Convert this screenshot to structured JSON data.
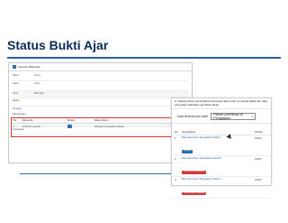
{
  "slide": {
    "title": "Status Bukti Ajar"
  },
  "left_panel": {
    "header": "Laporan Bukti Ajar",
    "fields": [
      {
        "label": "Nama",
        "value": "Dosen"
      },
      {
        "label": "Judul",
        "value": "Judul ..."
      },
      {
        "label": "Jenis",
        "value": "Bukti Ajar"
      },
      {
        "label": "Status",
        "value": ""
      }
    ],
    "sections": [
      "Pengajar"
    ],
    "fields2": [
      {
        "label": "Nama Dosen",
        "value": ""
      },
      {
        "label": "Tanggal",
        "value": "2024"
      },
      {
        "label": "Keterangan",
        "value": ""
      }
    ],
    "table": {
      "headers": [
        "No",
        "Nama File",
        "Berkas",
        "Status Sistem"
      ],
      "rows": [
        {
          "no": "1",
          "file": "Dokumen Ajar.pdf",
          "status": "Disetujui Pengesahan Ditolak ..."
        }
      ]
    }
  },
  "right_panel": {
    "info": "A. Rekomendasi pemindahan kelompok data untuk, termasuk daftar dan data yang akan dilakukan pemilihan lanjut.",
    "select_label": "Data tersedia dari tabel",
    "select_value": "Pilihan pemilihan di Pengajaran",
    "table": {
      "headers": [
        "No",
        "Pengaduan",
        "Pilihan"
      ],
      "rows": [
        {
          "no": "1",
          "name": "Bukti Ajar Dosen Pengajaran Kuliah A",
          "badge": "Disetujui",
          "badge_color": "blue",
          "value": "100%"
        },
        {
          "no": "2",
          "name": "Bukti Ajar Dosen Pengajaran Kuliah B",
          "badge": "Ditolak untuk Perbaikan",
          "badge_color": "red",
          "value": "100%"
        },
        {
          "no": "3",
          "name": "Bukti Ajar Dosen Pengajaran Kuliah C",
          "badge": "Ditolak untuk Perbaikan",
          "badge_color": "red",
          "value": "100%"
        }
      ]
    }
  },
  "colors": {
    "title": "#0a2a5a",
    "accent": "#2b5fa8",
    "highlight": "#e03030",
    "badge_blue": "#2a6fb0",
    "badge_red": "#d43a3a"
  }
}
